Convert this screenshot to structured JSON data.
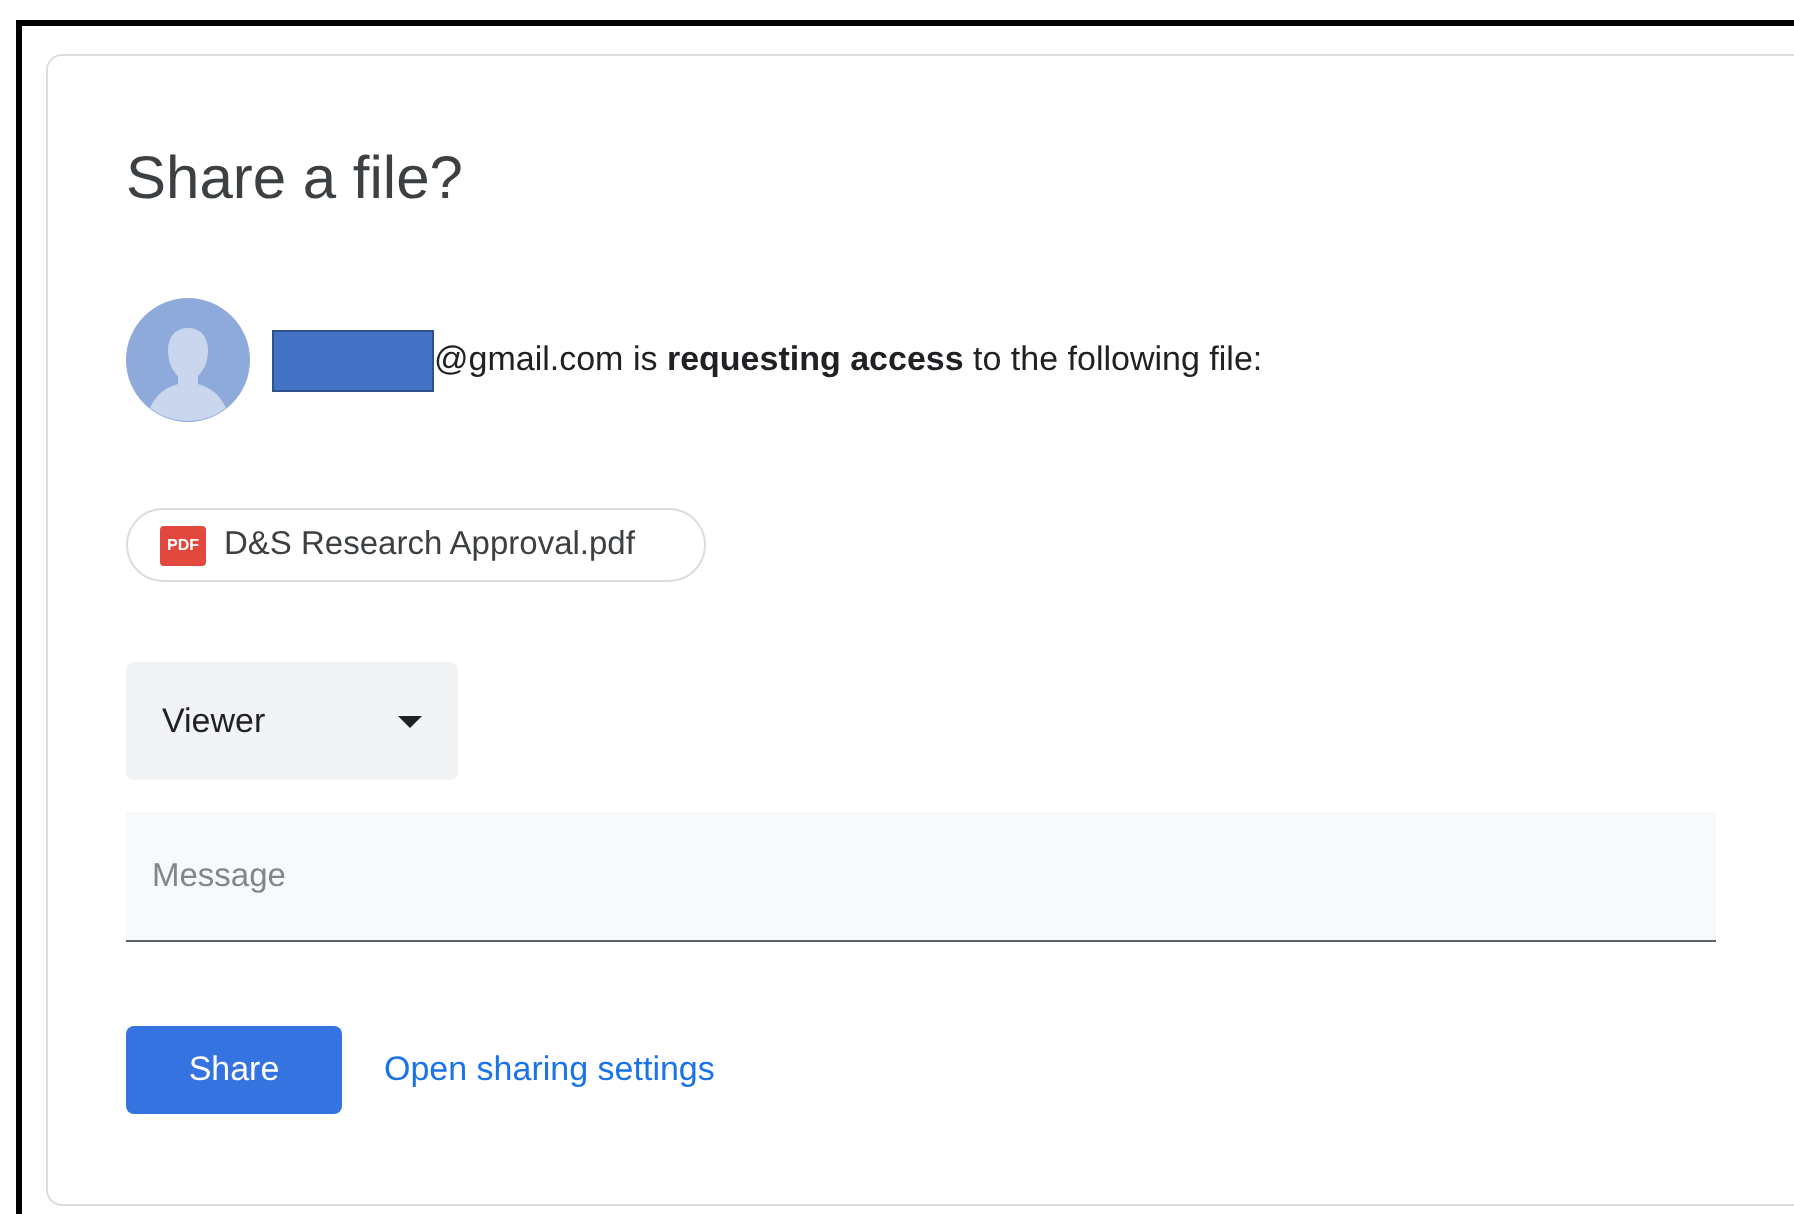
{
  "dialog": {
    "title": "Share a file?",
    "request": {
      "redacted": true,
      "text": "@gmail.com is **requesting access** to the following file:"
    },
    "file": {
      "icon_label": "PDF",
      "name": "D&S Research Approval.pdf"
    },
    "role_dropdown": {
      "value": "Viewer"
    },
    "message": {
      "placeholder": "Message"
    },
    "share_button": "Share",
    "settings_link": "Open sharing settings"
  }
}
